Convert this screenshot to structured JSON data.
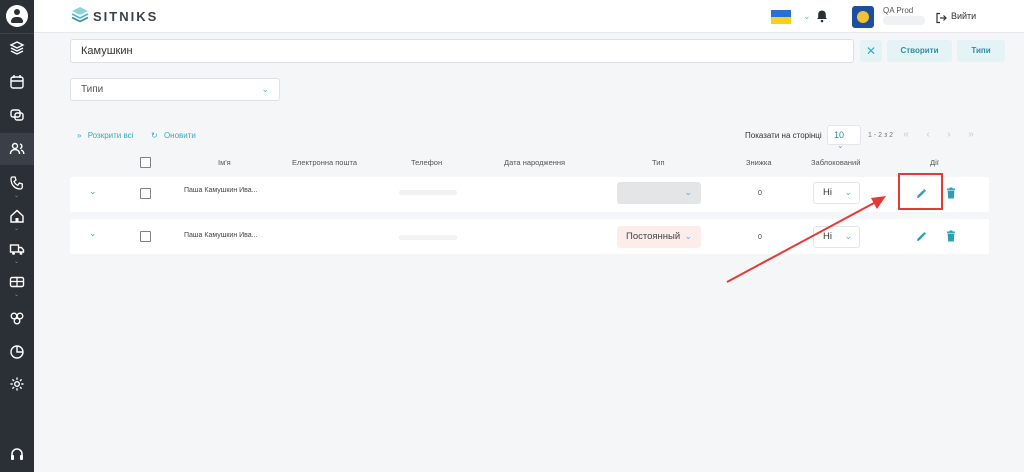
{
  "app": {
    "logo_text": "SITNIKS",
    "org_name": "QA Prod",
    "logout_label": "Вийти"
  },
  "sidebar": {
    "items": [
      {
        "icon": "user-avatar-icon"
      },
      {
        "icon": "layers-icon"
      },
      {
        "icon": "calendar-icon"
      },
      {
        "icon": "chat-icon"
      },
      {
        "icon": "users-icon",
        "active": true
      },
      {
        "icon": "phone-icon"
      },
      {
        "icon": "home-icon"
      },
      {
        "icon": "truck-icon"
      },
      {
        "icon": "wallet-icon"
      },
      {
        "icon": "groups-icon"
      },
      {
        "icon": "pie-chart-icon"
      },
      {
        "icon": "settings-icon"
      },
      {
        "icon": "headset-icon"
      }
    ]
  },
  "search": {
    "value": "Камушкин",
    "clear_label": "✕",
    "create_label": "Створити",
    "types_label": "Типи"
  },
  "filter": {
    "types_placeholder": "Типи"
  },
  "toolbar": {
    "expand_all": "Розкрити всі",
    "refresh": "Оновити",
    "per_page_label": "Показати на сторінці",
    "per_page_value": "10",
    "range": "1 - 2 з 2"
  },
  "table": {
    "headers": {
      "name": "Ім'я",
      "email": "Електронна пошта",
      "phone": "Телефон",
      "birthday": "Дата народження",
      "type": "Тип",
      "discount": "Знижка",
      "blocked": "Заблокований",
      "actions": "Дії"
    },
    "rows": [
      {
        "name": "Паша Камушкин Ива...",
        "type": "",
        "discount": "0",
        "blocked": "Ні"
      },
      {
        "name": "Паша Камушкин Ива...",
        "type": "Постоянный",
        "discount": "0",
        "blocked": "Ні"
      }
    ]
  },
  "colors": {
    "accent": "#3aa9bc",
    "sidebar": "#2b2f36",
    "annotation": "#e53935",
    "delete": "#2a9fb5"
  }
}
